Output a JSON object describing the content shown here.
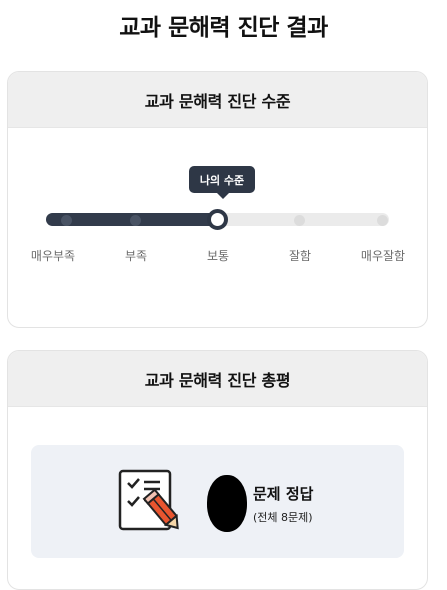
{
  "page": {
    "title": "교과 문해력 진단 결과"
  },
  "level_card": {
    "title": "교과 문해력 진단 수준",
    "tooltip": "나의 수준",
    "levels": [
      "매우부족",
      "부족",
      "보통",
      "잘함",
      "매우잘함"
    ],
    "selected_level": "보통",
    "selected_index": 2,
    "colors": {
      "active": "#2e3746",
      "inactive": "#ebebeb"
    }
  },
  "summary_card": {
    "title": "교과 문해력 진단 총평",
    "result_label": "문제 정답",
    "result_total": "(전체 8문제)",
    "icon": "checklist-pencil-icon"
  }
}
